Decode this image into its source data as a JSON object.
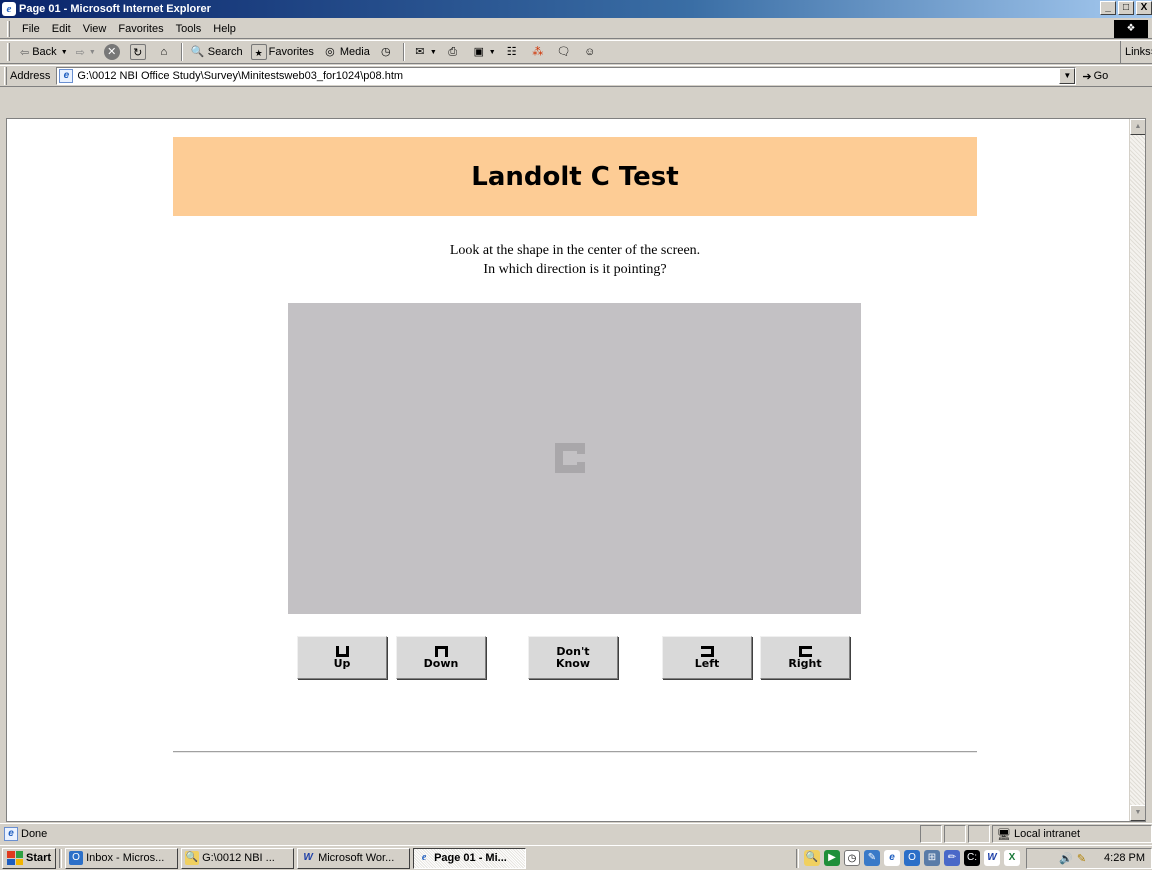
{
  "window": {
    "title": "Page 01 - Microsoft Internet Explorer",
    "controls": [
      "_",
      "□",
      "X"
    ]
  },
  "menu": [
    "File",
    "Edit",
    "View",
    "Favorites",
    "Tools",
    "Help"
  ],
  "toolbar": {
    "back": "Back",
    "search": "Search",
    "favorites": "Favorites",
    "media": "Media",
    "links": "Links"
  },
  "address": {
    "label": "Address",
    "url": "G:\\0012 NBI Office Study\\Survey\\Minitestsweb03_for1024\\p08.htm",
    "go": "Go"
  },
  "page": {
    "title": "Landolt C Test",
    "instruction_line1": "Look at the shape in the center of the screen.",
    "instruction_line2": "In which direction is it pointing?",
    "stimulus_color": "#c3c1c4",
    "header_color": "#fdcc95",
    "responses": [
      {
        "id": "up",
        "label": "Up",
        "icon": "landolt-up-icon"
      },
      {
        "id": "down",
        "label": "Down",
        "icon": "landolt-down-icon"
      },
      {
        "id": "dontknow",
        "line1": "Don't",
        "line2": "Know"
      },
      {
        "id": "left",
        "label": "Left",
        "icon": "landolt-left-icon"
      },
      {
        "id": "right",
        "label": "Right",
        "icon": "landolt-right-icon"
      }
    ]
  },
  "status": {
    "text": "Done",
    "zone": "Local intranet"
  },
  "taskbar": {
    "start": "Start",
    "tasks": [
      {
        "label": "Inbox - Micros...",
        "icon": "outlook-icon"
      },
      {
        "label": "G:\\0012 NBI ...",
        "icon": "folder-search-icon"
      },
      {
        "label": "Microsoft Wor...",
        "icon": "word-icon"
      },
      {
        "label": "Page 01 - Mi...",
        "icon": "ie-icon",
        "active": true
      }
    ],
    "clock": "4:28 PM"
  }
}
